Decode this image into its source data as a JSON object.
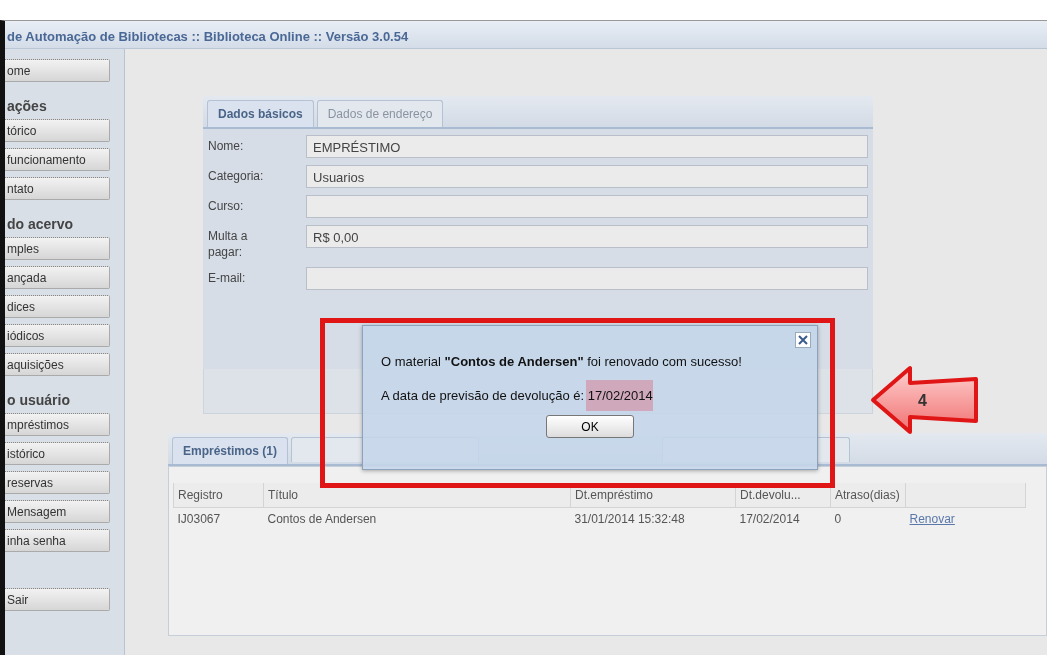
{
  "window": {
    "title": "de Automação de Bibliotecas :: Biblioteca Online :: Versão 3.0.54"
  },
  "sidebar": {
    "items": [
      {
        "kind": "button",
        "label": "ome"
      },
      {
        "kind": "section",
        "label": "ações"
      },
      {
        "kind": "button",
        "label": "tórico"
      },
      {
        "kind": "button",
        "label": "funcionamento"
      },
      {
        "kind": "button",
        "label": "ntato"
      },
      {
        "kind": "section",
        "label": "do acervo"
      },
      {
        "kind": "button",
        "label": "mples"
      },
      {
        "kind": "button",
        "label": "ançada"
      },
      {
        "kind": "button",
        "label": "dices"
      },
      {
        "kind": "button",
        "label": "iódicos"
      },
      {
        "kind": "button",
        "label": "aquisições"
      },
      {
        "kind": "section",
        "label": "o usuário"
      },
      {
        "kind": "button",
        "label": "mpréstimos"
      },
      {
        "kind": "button",
        "label": "istórico"
      },
      {
        "kind": "button",
        "label": "reservas"
      },
      {
        "kind": "button",
        "label": "Mensagem"
      },
      {
        "kind": "button",
        "label": "inha senha"
      },
      {
        "kind": "gap"
      },
      {
        "kind": "button",
        "label": "Sair"
      }
    ]
  },
  "form": {
    "tabs": [
      {
        "label": "Dados básicos",
        "selected": true
      },
      {
        "label": "Dados de endereço",
        "selected": false
      }
    ],
    "fields": [
      {
        "label": "Nome:",
        "value": "EMPRÉSTIMO"
      },
      {
        "label": "Categoria:",
        "value": "Usuarios"
      },
      {
        "label": "Curso:"
      },
      {
        "label": "Multa a pagar:",
        "value": "R$ 0,00"
      },
      {
        "label": "E-mail:"
      }
    ]
  },
  "loans": {
    "tabs": [
      {
        "label": "Empréstimos (1)",
        "selected": true
      }
    ],
    "table": {
      "columns": [
        "Registro",
        "Título",
        "Dt.empréstimo",
        "Dt.devolu...",
        "Atraso(dias)"
      ],
      "rows": [
        {
          "cells": [
            "IJ03067",
            "Contos de Andersen",
            "31/01/2014 15:32:48",
            "17/02/2014",
            "0"
          ],
          "action": "Renovar"
        }
      ]
    }
  },
  "dialog": {
    "message": "O material **\"Contos de Andersen\"** foi renovado com sucesso!",
    "date_line": "A data de previsão de devolução é: 17/02/2014",
    "button": "OK"
  },
  "annotation": {
    "step": "4"
  }
}
